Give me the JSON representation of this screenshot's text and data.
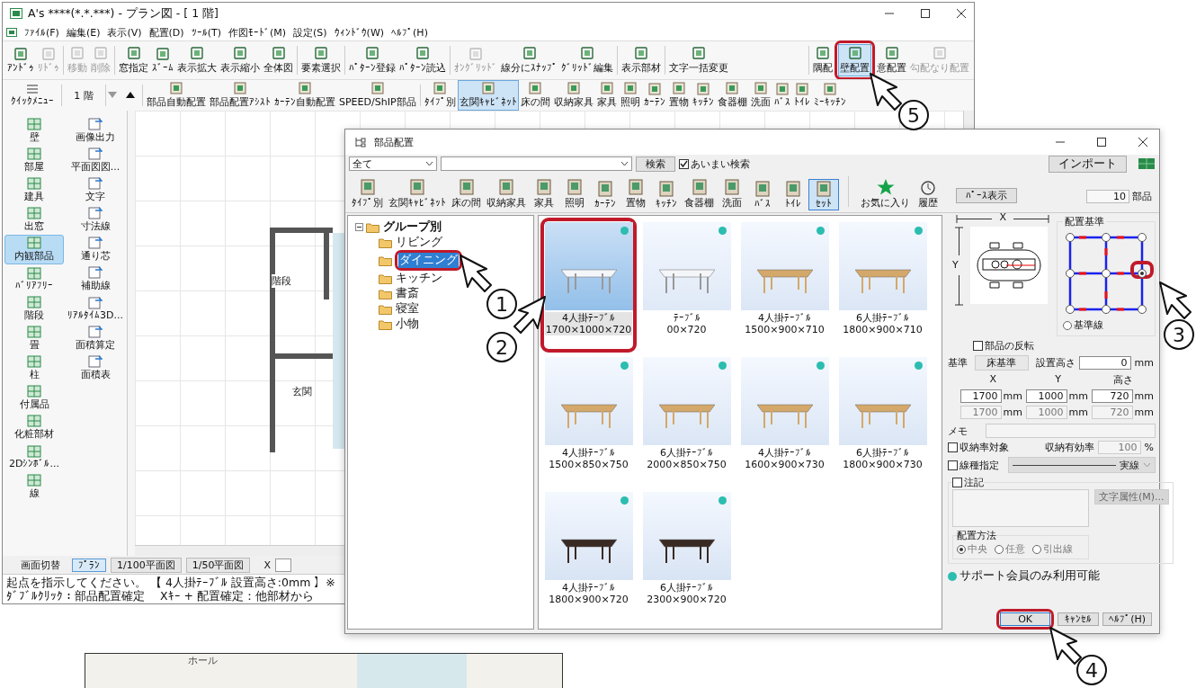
{
  "main_window": {
    "title": "A's ****(*.*.***) - プラン図 - [ 1 階]",
    "menu": [
      "ﾌｧｲﾙ(F)",
      "編集(E)",
      "表示(V)",
      "配置(D)",
      "ﾂｰﾙ(T)",
      "作図ﾓｰﾄﾞ(M)",
      "設定(S)",
      "ｳｨﾝﾄﾞｳ(W)",
      "ﾍﾙﾌﾟ(H)"
    ],
    "toolbar": [
      [
        {
          "label": "ｱﾝﾄﾞｩ",
          "disabled": false,
          "selected": false
        },
        {
          "label": "ﾘﾄﾞｩ",
          "disabled": true,
          "selected": false
        }
      ],
      [
        {
          "label": "移動",
          "disabled": true,
          "selected": false
        },
        {
          "label": "削除",
          "disabled": true,
          "selected": false
        }
      ],
      [
        {
          "label": "窓指定",
          "disabled": false,
          "selected": false
        },
        {
          "label": "ｽﾞｰﾑ",
          "disabled": false,
          "selected": false
        },
        {
          "label": "表示拡大",
          "disabled": false,
          "selected": false
        },
        {
          "label": "表示縮小",
          "disabled": false,
          "selected": false
        },
        {
          "label": "全体図",
          "disabled": false,
          "selected": false
        }
      ],
      [
        {
          "label": "要素選択",
          "disabled": false,
          "selected": false
        }
      ],
      [
        {
          "label": "ﾊﾟﾀｰﾝ登録",
          "disabled": false,
          "selected": false
        },
        {
          "label": "ﾊﾟﾀｰﾝ読込",
          "disabled": false,
          "selected": false
        }
      ],
      [
        {
          "label": "ｵﾝｸﾞﾘｯﾄﾞ",
          "disabled": true,
          "selected": false
        },
        {
          "label": "線分にｽﾅｯﾌﾟ",
          "disabled": false,
          "selected": false
        },
        {
          "label": "ｸﾞﾘｯﾄﾞ編集",
          "disabled": false,
          "selected": false
        }
      ],
      [
        {
          "label": "表示部材",
          "disabled": false,
          "selected": false
        }
      ],
      [
        {
          "label": "文字一括変更",
          "disabled": false,
          "selected": false
        }
      ],
      [
        {
          "label": "隅配",
          "disabled": false,
          "selected": false
        },
        {
          "label": "壁配置",
          "disabled": false,
          "selected": true
        },
        {
          "label": "意配置",
          "disabled": false,
          "selected": false
        },
        {
          "label": "勾配なり配置",
          "disabled": true,
          "selected": false
        }
      ]
    ],
    "quick_menu": "ｸｲｯｸﾒﾆｭｰ",
    "floor": "1 階",
    "toolbar2": [
      [
        {
          "label": "部品自動配置",
          "selected": false
        },
        {
          "label": "部品配置ｱｼｽﾄ",
          "selected": false
        },
        {
          "label": "ｶｰﾃﾝ自動配置",
          "selected": false
        },
        {
          "label": "SPEED/ShIP部品",
          "selected": false
        }
      ],
      [
        {
          "label": "ﾀｲﾌﾟ別",
          "selected": false
        },
        {
          "label": "玄関ｷｬﾋﾞﾈｯﾄ",
          "selected": true
        },
        {
          "label": "床の間",
          "selected": false
        },
        {
          "label": "収納家具",
          "selected": false
        },
        {
          "label": "家具",
          "selected": false
        },
        {
          "label": "照明",
          "selected": false
        },
        {
          "label": "ｶｰﾃﾝ",
          "selected": false
        },
        {
          "label": "置物",
          "selected": false
        },
        {
          "label": "ｷｯﾁﾝ",
          "selected": false
        },
        {
          "label": "食器棚",
          "selected": false
        },
        {
          "label": "洗面",
          "selected": false
        },
        {
          "label": "ﾊﾞｽ",
          "selected": false
        },
        {
          "label": "ﾄｲﾚ",
          "selected": false
        },
        {
          "label": "ﾐｰｷｯﾁﾝ",
          "selected": false
        }
      ]
    ],
    "sidebar": {
      "left": [
        {
          "label": "壁",
          "selected": false
        },
        {
          "label": "部屋",
          "selected": false
        },
        {
          "label": "建具",
          "selected": false
        },
        {
          "label": "出窓",
          "selected": false
        },
        {
          "label": "内観部品",
          "selected": true
        },
        {
          "label": "ﾊﾞﾘｱﾌﾘｰ",
          "selected": false
        },
        {
          "label": "階段",
          "selected": false
        },
        {
          "label": "畳",
          "selected": false
        },
        {
          "label": "柱",
          "selected": false
        },
        {
          "label": "付属品",
          "selected": false
        },
        {
          "label": "化粧部材",
          "selected": false
        },
        {
          "label": "2Dｼﾝﾎﾞﾙ...",
          "selected": false
        },
        {
          "label": "線",
          "selected": false
        }
      ],
      "right": [
        {
          "label": "画像出力",
          "selected": false
        },
        {
          "label": "平面図図...",
          "selected": false
        },
        {
          "label": "文字",
          "selected": false
        },
        {
          "label": "寸法線",
          "selected": false
        },
        {
          "label": "通り芯",
          "selected": false
        },
        {
          "label": "補助線",
          "selected": false
        },
        {
          "label": "ﾘｱﾙﾀｲﾑ3D...",
          "selected": false
        },
        {
          "label": "面積算定",
          "selected": false
        },
        {
          "label": "面積表",
          "selected": false
        }
      ]
    },
    "canvas_labels": [
      "階段",
      "玄関"
    ],
    "view_switch": {
      "label": "画面切替",
      "tabs": [
        {
          "label": "ﾌﾟﾗﾝ",
          "selected": true
        },
        {
          "label": "1/100平面図",
          "selected": false
        },
        {
          "label": "1/50平面図",
          "selected": false
        }
      ],
      "x_label": "X"
    },
    "status": "起点を指示してください。 【 4人掛ﾃｰﾌﾞﾙ 設置高さ:0mm 】※ﾀﾞﾌﾞﾙｸﾘｯｸ：部品配置確定　 Xｷｰ + 配置確定：他部材から"
  },
  "dialog": {
    "title": "部品配置",
    "filter": "全て",
    "search_button": "検索",
    "fuzzy": {
      "label": "あいまい検索",
      "checked": true
    },
    "import_button": "インポート",
    "categories": [
      {
        "label": "ﾀｲﾌﾟ別",
        "selected": false
      },
      {
        "label": "玄関ｷｬﾋﾞﾈｯﾄ",
        "selected": false
      },
      {
        "label": "床の間",
        "selected": false
      },
      {
        "label": "収納家具",
        "selected": false
      },
      {
        "label": "家具",
        "selected": false
      },
      {
        "label": "照明",
        "selected": false
      },
      {
        "label": "ｶｰﾃﾝ",
        "selected": false
      },
      {
        "label": "置物",
        "selected": false
      },
      {
        "label": "ｷｯﾁﾝ",
        "selected": false
      },
      {
        "label": "食器棚",
        "selected": false
      },
      {
        "label": "洗面",
        "selected": false
      },
      {
        "label": "ﾊﾞｽ",
        "selected": false
      },
      {
        "label": "ﾄｲﾚ",
        "selected": false
      },
      {
        "label": "ｾｯﾄ",
        "selected": true
      }
    ],
    "favorites": "お気に入り",
    "history": "履歴",
    "perspective_button": "ﾊﾟｰｽ表示",
    "count": "10",
    "count_unit": "部品",
    "tree": {
      "label": "グループ別",
      "expanded": true,
      "children": [
        {
          "label": "リビング",
          "selected": false
        },
        {
          "label": "ダイニング",
          "selected": true
        },
        {
          "label": "キッチン",
          "selected": false
        },
        {
          "label": "書斎",
          "selected": false
        },
        {
          "label": "寝室",
          "selected": false
        },
        {
          "label": "小物",
          "selected": false
        }
      ]
    },
    "items": [
      {
        "name": "4人掛ﾃｰﾌﾞﾙ",
        "size": "1700×1000×720",
        "selected": true,
        "support_only": true
      },
      {
        "name": "ﾃｰﾌﾞﾙ",
        "size": "00×720",
        "selected": false,
        "support_only": true
      },
      {
        "name": "4人掛ﾃｰﾌﾞﾙ",
        "size": "1500×900×710",
        "selected": false,
        "support_only": true
      },
      {
        "name": "6人掛ﾃｰﾌﾞﾙ",
        "size": "1800×900×710",
        "selected": false,
        "support_only": true
      },
      {
        "name": "4人掛ﾃｰﾌﾞﾙ",
        "size": "1500×850×750",
        "selected": false,
        "support_only": true
      },
      {
        "name": "6人掛ﾃｰﾌﾞﾙ",
        "size": "2000×850×750",
        "selected": false,
        "support_only": true
      },
      {
        "name": "4人掛ﾃｰﾌﾞﾙ",
        "size": "1600×900×730",
        "selected": false,
        "support_only": true
      },
      {
        "name": "6人掛ﾃｰﾌﾞﾙ",
        "size": "1800×900×730",
        "selected": false,
        "support_only": true
      },
      {
        "name": "4人掛ﾃｰﾌﾞﾙ",
        "size": "1800×900×720",
        "selected": false,
        "support_only": true
      },
      {
        "name": "6人掛ﾃｰﾌﾞﾙ",
        "size": "2300×900×720",
        "selected": false,
        "support_only": true
      }
    ],
    "panel": {
      "x_label": "X",
      "y_label": "Y",
      "anchor_title": "配置基準",
      "anchors": [
        {
          "selected": false
        },
        {
          "selected": false
        },
        {
          "selected": false
        },
        {
          "selected": false
        },
        {
          "selected": false
        },
        {
          "selected": true
        },
        {
          "selected": false
        },
        {
          "selected": false
        },
        {
          "selected": false
        }
      ],
      "baseline": {
        "label": "基準線",
        "selected": false
      },
      "flip": {
        "label": "部品の反転",
        "checked": false
      },
      "base_label": "基準",
      "base_value": "床基準",
      "height_label": "設置高さ",
      "height": {
        "value": "0",
        "unit": "mm"
      },
      "size_headers": [
        "X",
        "Y",
        "高さ"
      ],
      "size_rows": [
        {
          "disabled": false,
          "cells": [
            {
              "value": "1700",
              "unit": "mm"
            },
            {
              "value": "1000",
              "unit": "mm"
            },
            {
              "value": "720",
              "unit": "mm"
            }
          ]
        },
        {
          "disabled": true,
          "cells": [
            {
              "value": "1700",
              "unit": "mm"
            },
            {
              "value": "1000",
              "unit": "mm"
            },
            {
              "value": "720",
              "unit": "mm"
            }
          ]
        }
      ],
      "memo_label": "メモ",
      "storage": {
        "label": "収納率対象",
        "checked": false
      },
      "ratio": {
        "label": "収納有効率",
        "value": "100",
        "unit": "%"
      },
      "linetype": {
        "label": "線種指定",
        "checked": false,
        "value": "実線"
      },
      "note": {
        "label": "注記",
        "checked": false,
        "button": "文字属性(M)...",
        "method_title": "配置方法",
        "methods": [
          {
            "label": "中央",
            "selected": true
          },
          {
            "label": "任意",
            "selected": false
          },
          {
            "label": "引出線",
            "selected": false
          }
        ]
      },
      "legend": {
        "label": "サポート会員のみ利用可能",
        "color": "#2bbdb0"
      }
    },
    "buttons": [
      "OK",
      "ｷｬﾝｾﾙ",
      "ﾍﾙﾌﾟ(H)"
    ]
  },
  "lower_plan": {
    "label": "ホール"
  },
  "callouts": [
    "1",
    "2",
    "3",
    "4",
    "5"
  ]
}
